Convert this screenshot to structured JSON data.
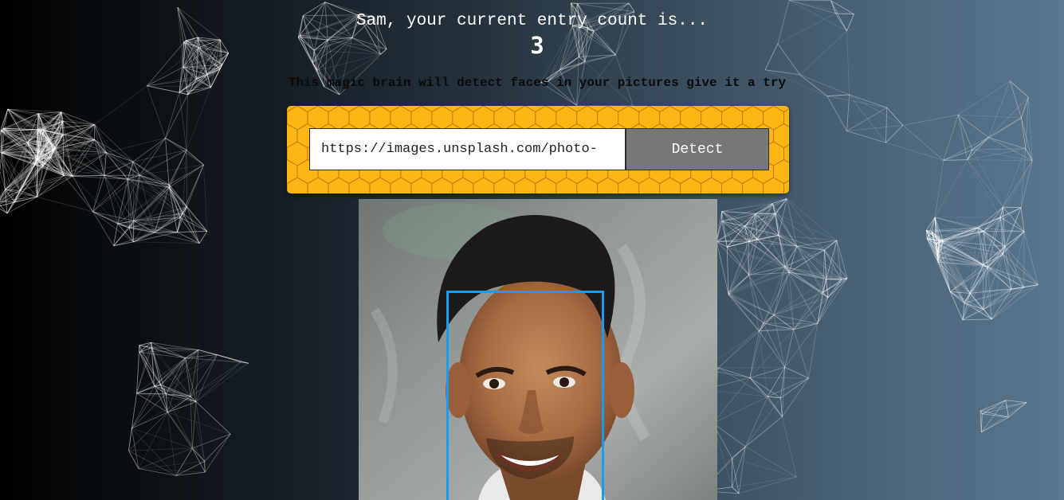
{
  "header": {
    "greeting": "Sam, your current entry count is...",
    "entry_count": "3",
    "tagline": "This magic brain will detect faces in your pictures give it a try"
  },
  "form": {
    "url_value": "https://images.unsplash.com/photo-",
    "detect_label": "Detect"
  },
  "colors": {
    "panel": "#fbb514",
    "button": "#777777",
    "face_box": "#149df2"
  }
}
